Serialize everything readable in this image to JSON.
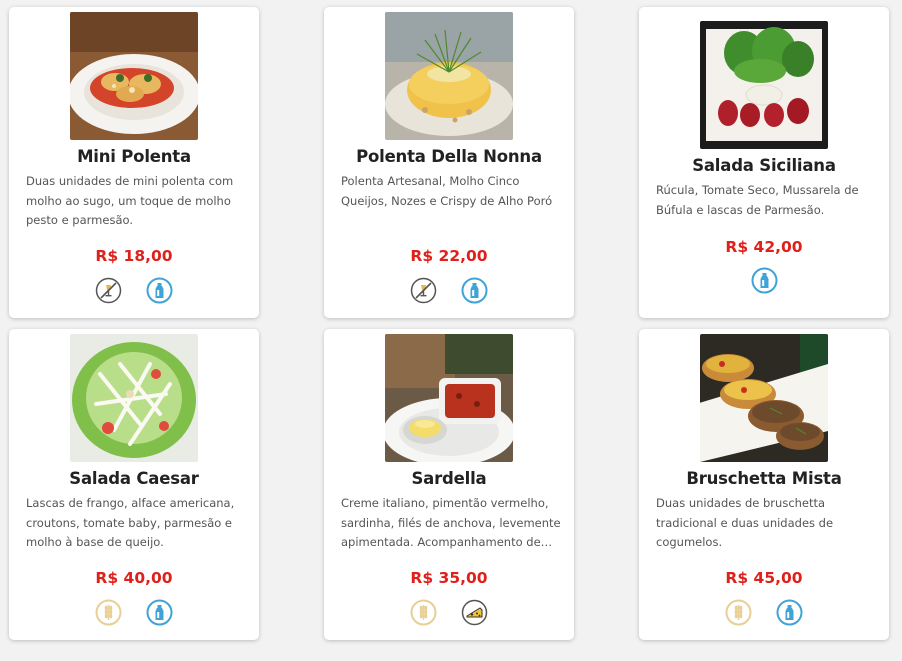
{
  "menu": {
    "items": [
      {
        "title": "Mini Polenta",
        "description": "Duas unidades de mini polenta com molho ao sugo, um toque de molho pesto e parmesão.",
        "price": "R$ 18,00",
        "image": "mini-polenta-photo",
        "badges": [
          "no-alcohol-icon",
          "milk-bottle-icon"
        ]
      },
      {
        "title": "Polenta Della Nonna",
        "description": "Polenta Artesanal, Molho Cinco Queijos, Nozes e Crispy de Alho Poró",
        "price": "R$ 22,00",
        "image": "polenta-della-nonna-photo",
        "badges": [
          "no-alcohol-icon",
          "milk-bottle-icon"
        ]
      },
      {
        "title": "Salada Siciliana",
        "description": "Rúcula, Tomate Seco, Mussarela de Búfula e lascas de Parmesão.",
        "price": "R$ 42,00",
        "image": "salada-siciliana-photo",
        "badges": [
          "milk-bottle-icon"
        ]
      },
      {
        "title": "Salada Caesar",
        "description": "Lascas de frango, alface americana, croutons, tomate baby, parmesão e molho à base de queijo.",
        "price": "R$ 40,00",
        "image": "salada-caesar-photo",
        "badges": [
          "wheat-icon",
          "milk-bottle-icon"
        ]
      },
      {
        "title": "Sardella",
        "description": "Creme italiano, pimentão vermelho, sardinha, filés de anchova, levemente apimentada. Acompanhamento de pão.",
        "price": "R$ 35,00",
        "image": "sardella-photo",
        "badges": [
          "wheat-icon",
          "cheese-icon"
        ]
      },
      {
        "title": "Bruschetta Mista",
        "description": "Duas unidades de bruschetta tradicional e duas unidades de cogumelos.",
        "price": "R$ 45,00",
        "image": "bruschetta-mista-photo",
        "badges": [
          "wheat-icon",
          "milk-bottle-icon"
        ]
      }
    ]
  },
  "colors": {
    "price": "#e0201b",
    "title": "#222222",
    "description": "#555555",
    "milk_badge": "#3fa3d8",
    "wheat_badge": "#e8cf95",
    "alcohol_badge": "#555555",
    "card_background": "#ffffff",
    "page_background": "#f2f2f2"
  }
}
